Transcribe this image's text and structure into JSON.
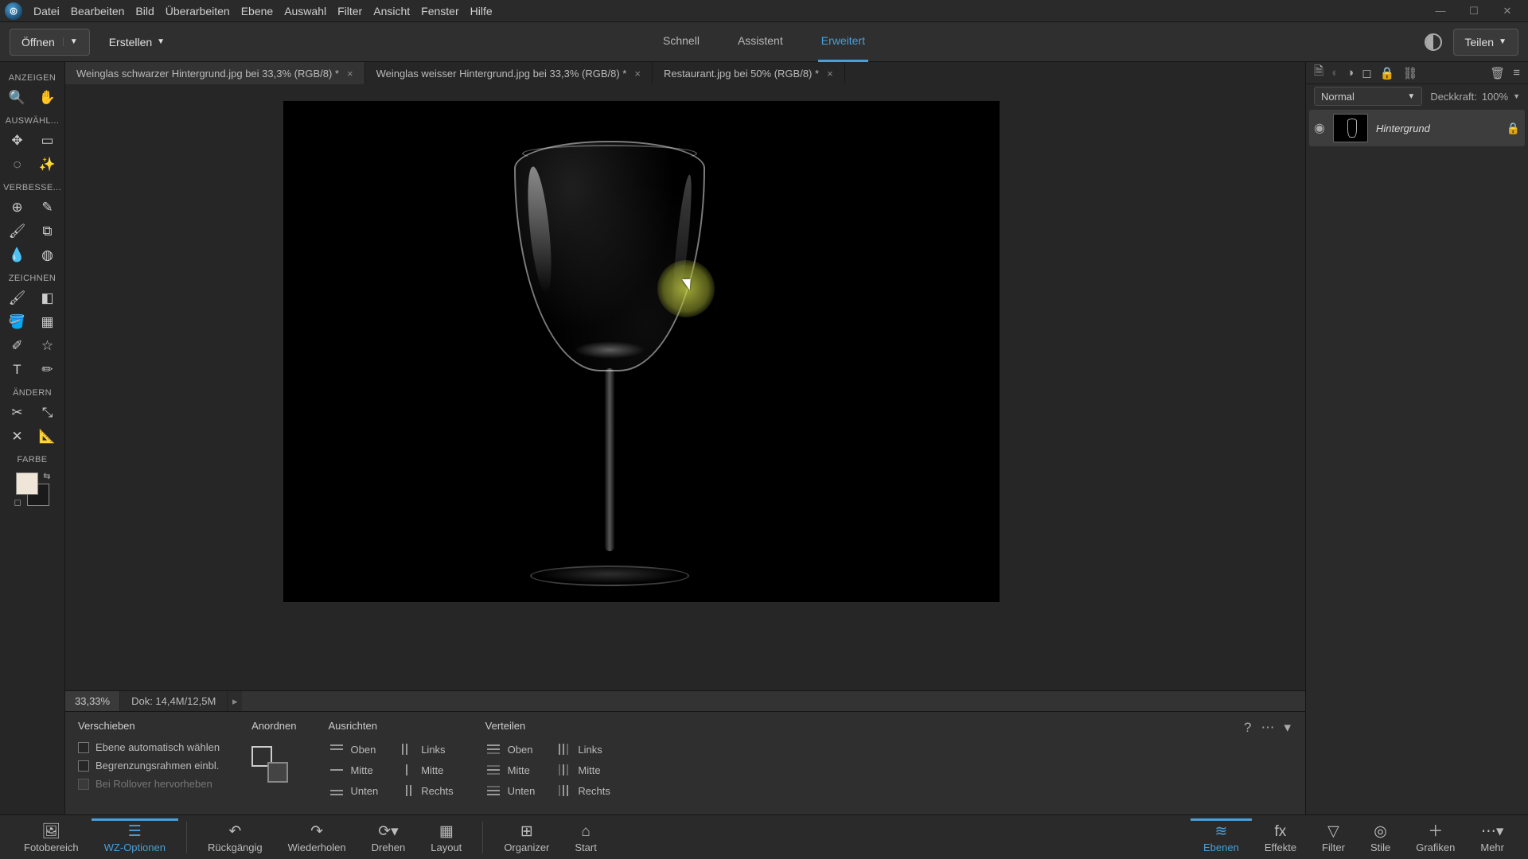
{
  "menu": [
    "Datei",
    "Bearbeiten",
    "Bild",
    "Überarbeiten",
    "Ebene",
    "Auswahl",
    "Filter",
    "Ansicht",
    "Fenster",
    "Hilfe"
  ],
  "actionbar": {
    "open": "Öffnen",
    "create": "Erstellen",
    "share": "Teilen"
  },
  "modes": {
    "schnell": "Schnell",
    "assistent": "Assistent",
    "erweitert": "Erweitert"
  },
  "tabs": [
    {
      "label": "Weinglas schwarzer Hintergrund.jpg bei 33,3% (RGB/8) *"
    },
    {
      "label": "Weinglas weisser Hintergrund.jpg bei 33,3% (RGB/8) *"
    },
    {
      "label": "Restaurant.jpg bei 50% (RGB/8) *"
    }
  ],
  "toolbox": {
    "groups": {
      "anzeigen": "ANZEIGEN",
      "auswaehl": "AUSWÄHL...",
      "verbesse": "VERBESSE...",
      "zeichnen": "ZEICHNEN",
      "aendern": "ÄNDERN",
      "farbe": "FARBE"
    }
  },
  "status": {
    "zoom": "33,33%",
    "doc": "Dok: 14,4M/12,5M"
  },
  "layers": {
    "blend": "Normal",
    "opacity_label": "Deckkraft:",
    "opacity_value": "100%",
    "layer0": "Hintergrund"
  },
  "options": {
    "tool": "Verschieben",
    "auto_select": "Ebene automatisch wählen",
    "bounding": "Begrenzungsrahmen einbl.",
    "rollover": "Bei Rollover hervorheben",
    "anordnen": "Anordnen",
    "ausrichten": "Ausrichten",
    "verteilen": "Verteilen",
    "oben": "Oben",
    "mitte": "Mitte",
    "unten": "Unten",
    "links": "Links",
    "rechts": "Rechts"
  },
  "bottombar": {
    "fotobereich": "Fotobereich",
    "wzoptionen": "WZ-Optionen",
    "rueckgaengig": "Rückgängig",
    "wiederholen": "Wiederholen",
    "drehen": "Drehen",
    "layout": "Layout",
    "organizer": "Organizer",
    "start": "Start",
    "ebenen": "Ebenen",
    "effekte": "Effekte",
    "filter": "Filter",
    "stile": "Stile",
    "grafiken": "Grafiken",
    "mehr": "Mehr"
  }
}
